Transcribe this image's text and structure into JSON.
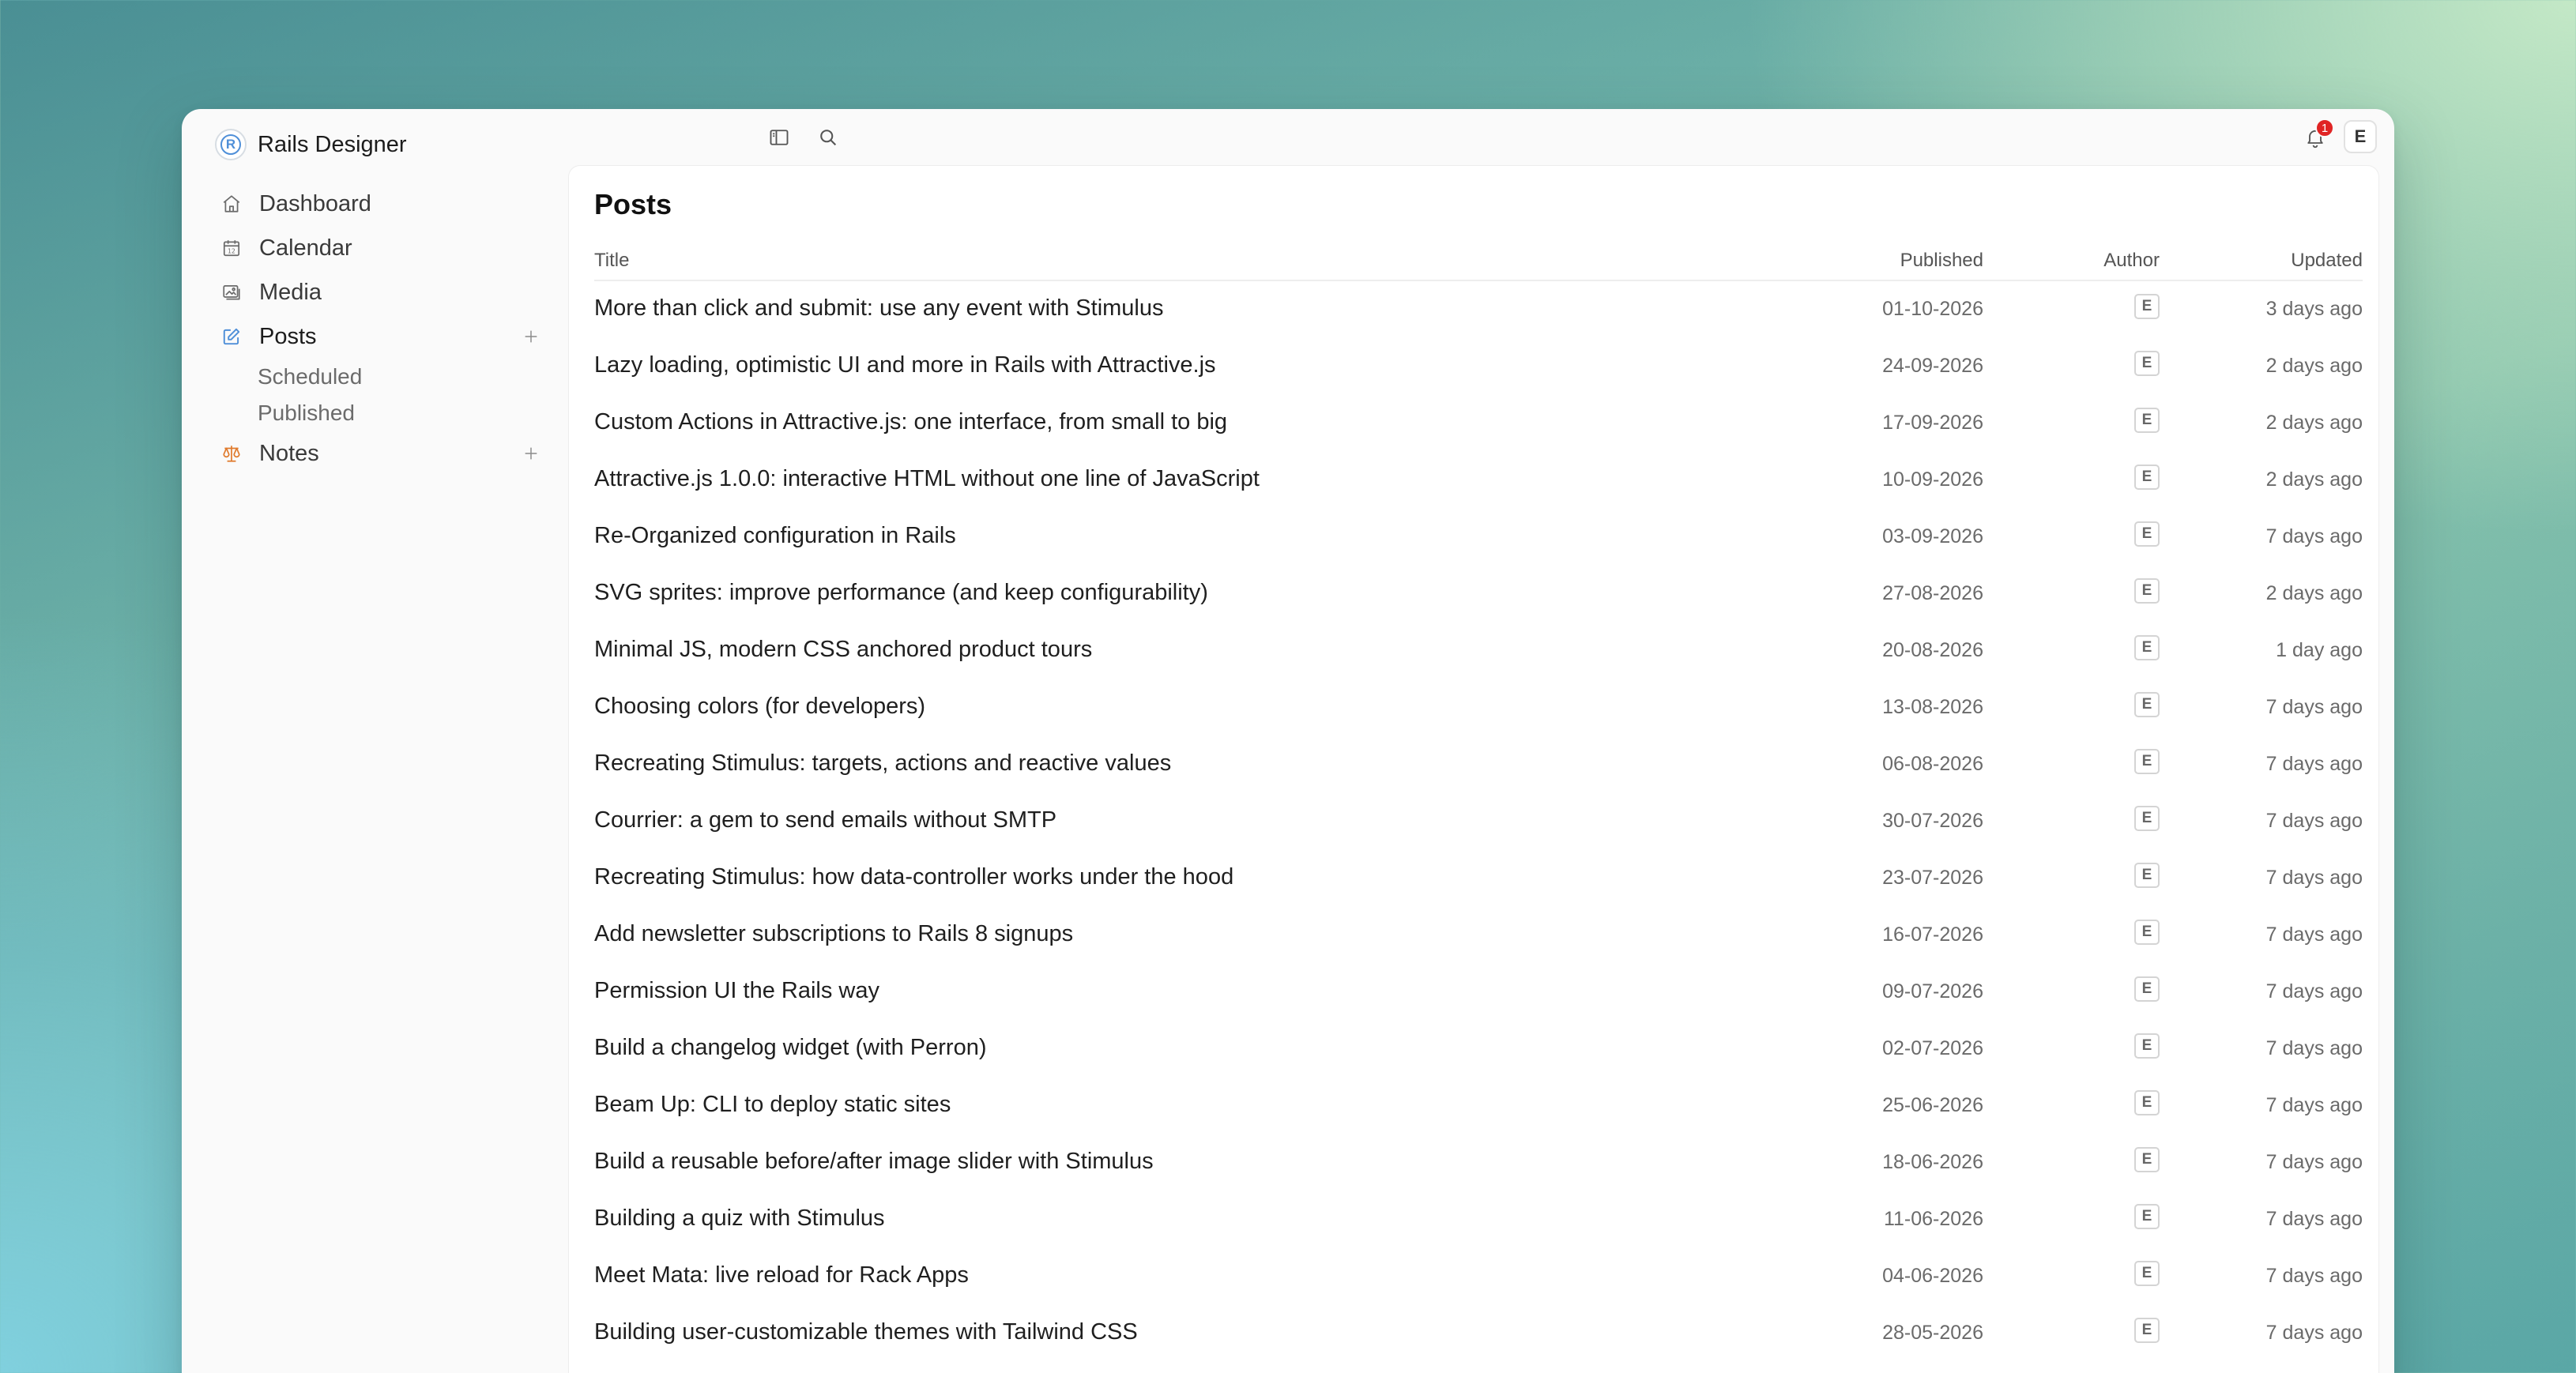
{
  "app": {
    "name": "Rails Designer",
    "logo_letter": "R"
  },
  "sidebar": {
    "items": [
      {
        "label": "Dashboard",
        "icon": "home-icon"
      },
      {
        "label": "Calendar",
        "icon": "calendar-icon"
      },
      {
        "label": "Media",
        "icon": "images-icon"
      },
      {
        "label": "Posts",
        "icon": "edit-icon",
        "active": true,
        "sub": [
          "Scheduled",
          "Published"
        ]
      },
      {
        "label": "Notes",
        "icon": "scale-icon",
        "accent": "#e07b2e"
      }
    ]
  },
  "topbar": {
    "notification_count": "1",
    "user_initial": "E"
  },
  "main": {
    "title": "Posts",
    "columns": {
      "title": "Title",
      "published": "Published",
      "author": "Author",
      "updated": "Updated"
    },
    "rows": [
      {
        "title": "More than click and submit: use any event with Stimulus",
        "published": "01-10-2026",
        "author": "E",
        "updated": "3 days ago"
      },
      {
        "title": "Lazy loading, optimistic UI and more in Rails with Attractive.js",
        "published": "24-09-2026",
        "author": "E",
        "updated": "2 days ago"
      },
      {
        "title": "Custom Actions in Attractive.js: one interface, from small to big",
        "published": "17-09-2026",
        "author": "E",
        "updated": "2 days ago"
      },
      {
        "title": "Attractive.js 1.0.0: interactive HTML without one line of JavaScript",
        "published": "10-09-2026",
        "author": "E",
        "updated": "2 days ago"
      },
      {
        "title": "Re-Organized configuration in Rails",
        "published": "03-09-2026",
        "author": "E",
        "updated": "7 days ago"
      },
      {
        "title": "SVG sprites: improve performance (and keep configurability)",
        "published": "27-08-2026",
        "author": "E",
        "updated": "2 days ago"
      },
      {
        "title": "Minimal JS, modern CSS anchored product tours",
        "published": "20-08-2026",
        "author": "E",
        "updated": "1 day ago"
      },
      {
        "title": "Choosing colors (for developers)",
        "published": "13-08-2026",
        "author": "E",
        "updated": "7 days ago"
      },
      {
        "title": "Recreating Stimulus: targets, actions and reactive values",
        "published": "06-08-2026",
        "author": "E",
        "updated": "7 days ago"
      },
      {
        "title": "Courrier: a gem to send emails without SMTP",
        "published": "30-07-2026",
        "author": "E",
        "updated": "7 days ago"
      },
      {
        "title": "Recreating Stimulus: how data-controller works under the hood",
        "published": "23-07-2026",
        "author": "E",
        "updated": "7 days ago"
      },
      {
        "title": "Add newsletter subscriptions to Rails 8 signups",
        "published": "16-07-2026",
        "author": "E",
        "updated": "7 days ago"
      },
      {
        "title": "Permission UI the Rails way",
        "published": "09-07-2026",
        "author": "E",
        "updated": "7 days ago"
      },
      {
        "title": "Build a changelog widget (with Perron)",
        "published": "02-07-2026",
        "author": "E",
        "updated": "7 days ago"
      },
      {
        "title": "Beam Up: CLI to deploy static sites",
        "published": "25-06-2026",
        "author": "E",
        "updated": "7 days ago"
      },
      {
        "title": "Build a reusable before/after image slider with Stimulus",
        "published": "18-06-2026",
        "author": "E",
        "updated": "7 days ago"
      },
      {
        "title": "Building a quiz with Stimulus",
        "published": "11-06-2026",
        "author": "E",
        "updated": "7 days ago"
      },
      {
        "title": "Meet Mata: live reload for Rack Apps",
        "published": "04-06-2026",
        "author": "E",
        "updated": "7 days ago"
      },
      {
        "title": "Building user-customizable themes with Tailwind CSS",
        "published": "28-05-2026",
        "author": "E",
        "updated": "7 days ago"
      }
    ]
  },
  "colors": {
    "accent_blue": "#4f8fd8",
    "notes_orange": "#e07b2e",
    "badge_red": "#e02424"
  }
}
